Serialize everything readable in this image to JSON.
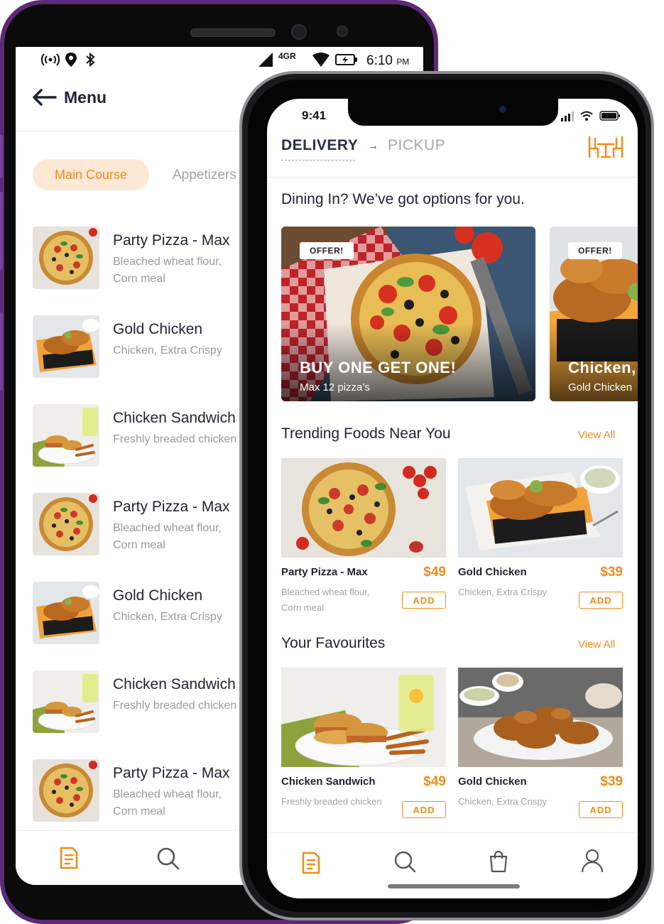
{
  "android": {
    "status": {
      "time": "6:10",
      "ampm": "PM",
      "network": "4GR"
    },
    "header": {
      "title": "Menu"
    },
    "chips": [
      "Main Course",
      "Appetizers"
    ],
    "items": [
      {
        "name": "Party Pizza - Max",
        "desc": "Bleached wheat flour, Corn meal",
        "image": "pizza"
      },
      {
        "name": "Gold Chicken",
        "desc": "Chicken, Extra Crispy",
        "image": "chicken"
      },
      {
        "name": "Chicken Sandwich",
        "desc": "Freshly breaded chicken",
        "image": "sandwich"
      },
      {
        "name": "Party Pizza - Max",
        "desc": "Bleached wheat flour, Corn meal",
        "image": "pizza"
      },
      {
        "name": "Gold Chicken",
        "desc": "Chicken, Extra Crispy",
        "image": "chicken"
      },
      {
        "name": "Chicken Sandwich",
        "desc": "Freshly breaded chicken",
        "image": "sandwich"
      },
      {
        "name": "Party Pizza - Max",
        "desc": "Bleached wheat flour, Corn meal",
        "image": "pizza"
      }
    ],
    "nav": [
      "menu-icon",
      "search-icon"
    ]
  },
  "iphone": {
    "status": {
      "time": "9:41"
    },
    "tabs": {
      "delivery": "DELIVERY",
      "arrow": "→",
      "pickup": "PICKUP"
    },
    "heading": "Dining In? We’ve got options for you.",
    "offers": [
      {
        "badge": "OFFER!",
        "title": "BUY ONE GET ONE!",
        "sub": "Max 12 pizza’s"
      },
      {
        "badge": "OFFER!",
        "title": "Chicken,",
        "sub": "Gold Chicken"
      }
    ],
    "trending": {
      "title": "Trending Foods Near You",
      "view_all": "View All",
      "items": [
        {
          "name": "Party Pizza - Max",
          "price": "$49",
          "desc": "Bleached wheat flour, Corn meal",
          "add": "ADD"
        },
        {
          "name": "Gold Chicken",
          "price": "$39",
          "desc": "Chicken, Extra Crispy",
          "add": "ADD"
        }
      ]
    },
    "favourites": {
      "title": "Your Favourites",
      "view_all": "View All",
      "items": [
        {
          "name": "Chicken Sandwich",
          "price": "$49",
          "desc": "Freshly breaded chicken",
          "add": "ADD"
        },
        {
          "name": "Gold Chicken",
          "price": "$39",
          "desc": "Chicken, Extra Crispy",
          "add": "ADD"
        }
      ]
    },
    "nav": [
      "menu-icon",
      "search-icon",
      "bag-icon",
      "profile-icon"
    ]
  },
  "colors": {
    "accent": "#f08c1a",
    "chip_bg": "#fde8d6",
    "text_dark": "#1f2233",
    "text_muted": "#a3a3a3",
    "android_frame": "#5c2a78"
  }
}
